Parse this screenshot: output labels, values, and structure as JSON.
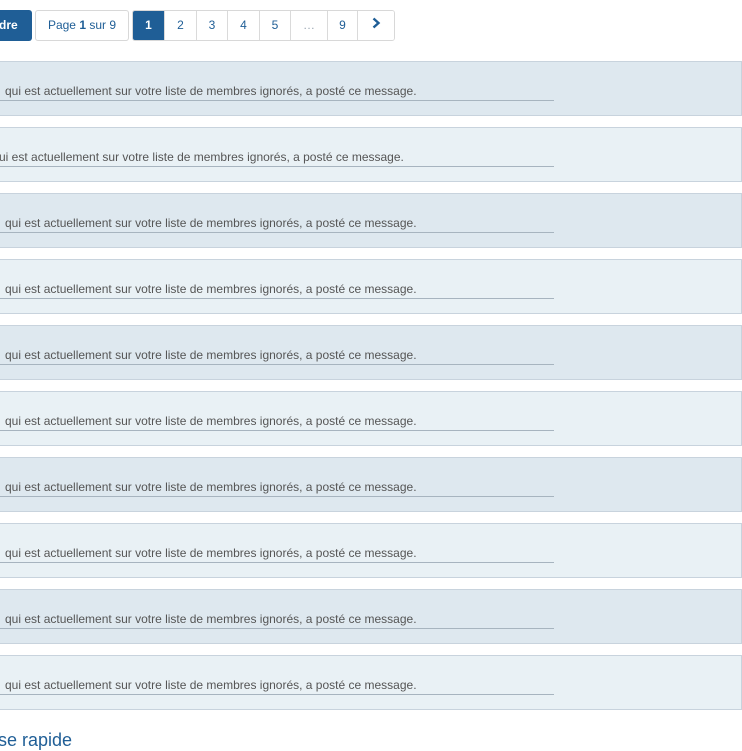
{
  "toolbar": {
    "reply_label": "dre",
    "page_prefix": "Page ",
    "page_current": "1",
    "page_middle": " sur ",
    "page_total": "9",
    "pages": [
      "1",
      "2",
      "3",
      "4",
      "5",
      "…",
      "9"
    ]
  },
  "posts": [
    {
      "message": "qui est actuellement sur votre liste de membres ignorés, a posté ce message."
    },
    {
      "message": "ui est actuellement sur votre liste de membres ignorés, a posté ce message."
    },
    {
      "message": "qui est actuellement sur votre liste de membres ignorés, a posté ce message."
    },
    {
      "message": "qui est actuellement sur votre liste de membres ignorés, a posté ce message."
    },
    {
      "message": "qui est actuellement sur votre liste de membres ignorés, a posté ce message."
    },
    {
      "message": "qui est actuellement sur votre liste de membres ignorés, a posté ce message."
    },
    {
      "message": "qui est actuellement sur votre liste de membres ignorés, a posté ce message."
    },
    {
      "message": "qui est actuellement sur votre liste de membres ignorés, a posté ce message."
    },
    {
      "message": "qui est actuellement sur votre liste de membres ignorés, a posté ce message."
    },
    {
      "message": "qui est actuellement sur votre liste de membres ignorés, a posté ce message."
    }
  ],
  "quick_reply": {
    "title": "se rapide"
  },
  "icons": {
    "next": "chevron-right-icon"
  },
  "colors": {
    "accent": "#1f5e96",
    "row_dark": "#dee8ef",
    "row_light": "#e9f1f5"
  }
}
